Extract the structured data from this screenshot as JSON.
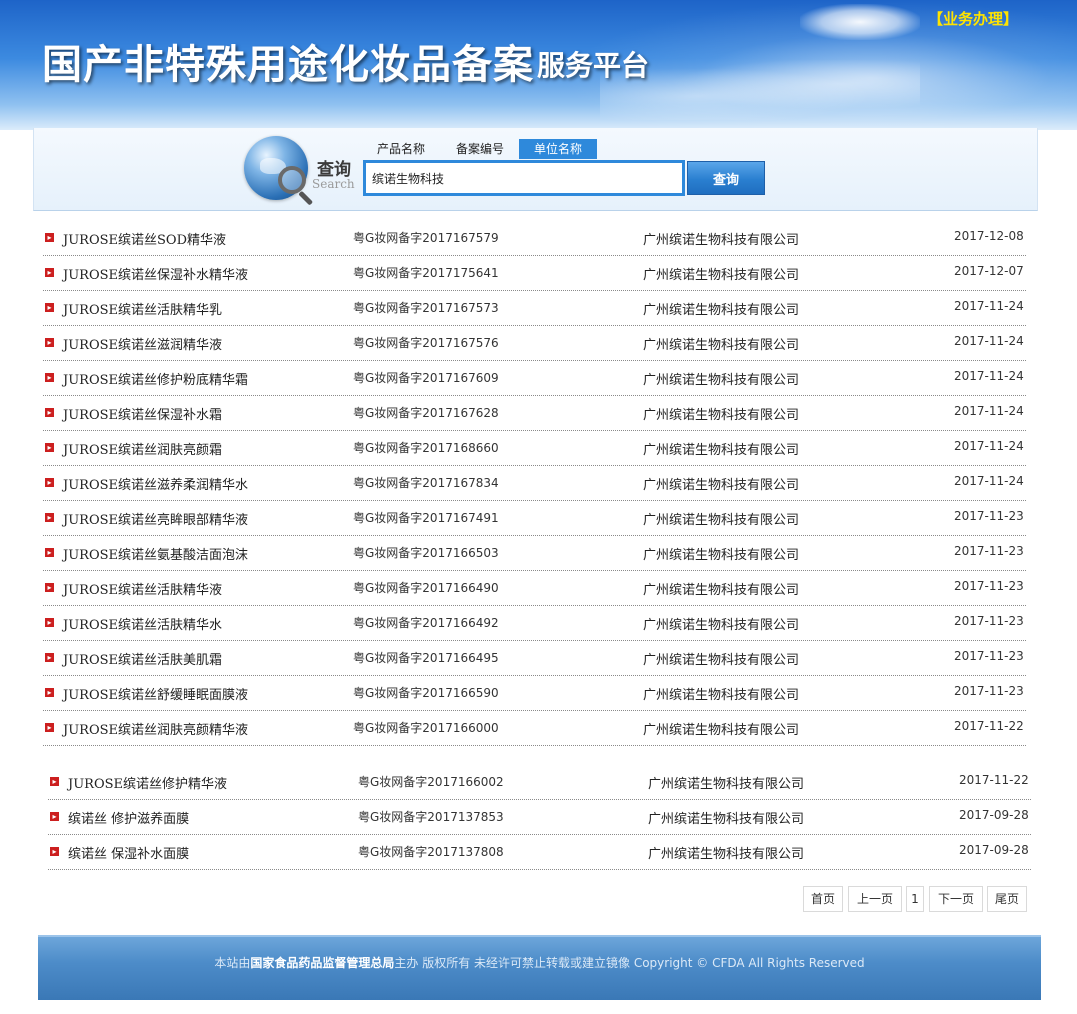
{
  "header": {
    "title": "国产非特殊用途化妆品备案",
    "subtitle": "服务平台",
    "business_link": "【业务办理】"
  },
  "search": {
    "label": "查询",
    "label_en": "Search",
    "tabs": [
      "产品名称",
      "备案编号",
      "单位名称"
    ],
    "active_tab": "单位名称",
    "query": "缤诺生物科技",
    "button": "查询"
  },
  "results": [
    {
      "name": "JUROSE缤诺丝SOD精华液",
      "code": "粤G妆网备字2017167579",
      "company": "广州缤诺生物科技有限公司",
      "date": "2017-12-08"
    },
    {
      "name": "JUROSE缤诺丝保湿补水精华液",
      "code": "粤G妆网备字2017175641",
      "company": "广州缤诺生物科技有限公司",
      "date": "2017-12-07"
    },
    {
      "name": "JUROSE缤诺丝活肤精华乳",
      "code": "粤G妆网备字2017167573",
      "company": "广州缤诺生物科技有限公司",
      "date": "2017-11-24"
    },
    {
      "name": "JUROSE缤诺丝滋润精华液",
      "code": "粤G妆网备字2017167576",
      "company": "广州缤诺生物科技有限公司",
      "date": "2017-11-24"
    },
    {
      "name": "JUROSE缤诺丝修护粉底精华霜",
      "code": "粤G妆网备字2017167609",
      "company": "广州缤诺生物科技有限公司",
      "date": "2017-11-24"
    },
    {
      "name": "JUROSE缤诺丝保湿补水霜",
      "code": "粤G妆网备字2017167628",
      "company": "广州缤诺生物科技有限公司",
      "date": "2017-11-24"
    },
    {
      "name": "JUROSE缤诺丝润肤亮颜霜",
      "code": "粤G妆网备字2017168660",
      "company": "广州缤诺生物科技有限公司",
      "date": "2017-11-24"
    },
    {
      "name": "JUROSE缤诺丝滋养柔润精华水",
      "code": "粤G妆网备字2017167834",
      "company": "广州缤诺生物科技有限公司",
      "date": "2017-11-24"
    },
    {
      "name": "JUROSE缤诺丝亮眸眼部精华液",
      "code": "粤G妆网备字2017167491",
      "company": "广州缤诺生物科技有限公司",
      "date": "2017-11-23"
    },
    {
      "name": "JUROSE缤诺丝氨基酸洁面泡沫",
      "code": "粤G妆网备字2017166503",
      "company": "广州缤诺生物科技有限公司",
      "date": "2017-11-23"
    },
    {
      "name": "JUROSE缤诺丝活肤精华液",
      "code": "粤G妆网备字2017166490",
      "company": "广州缤诺生物科技有限公司",
      "date": "2017-11-23"
    },
    {
      "name": "JUROSE缤诺丝活肤精华水",
      "code": "粤G妆网备字2017166492",
      "company": "广州缤诺生物科技有限公司",
      "date": "2017-11-23"
    },
    {
      "name": "JUROSE缤诺丝活肤美肌霜",
      "code": "粤G妆网备字2017166495",
      "company": "广州缤诺生物科技有限公司",
      "date": "2017-11-23"
    },
    {
      "name": "JUROSE缤诺丝舒缓睡眠面膜液",
      "code": "粤G妆网备字2017166590",
      "company": "广州缤诺生物科技有限公司",
      "date": "2017-11-23"
    },
    {
      "name": "JUROSE缤诺丝润肤亮颜精华液",
      "code": "粤G妆网备字2017166000",
      "company": "广州缤诺生物科技有限公司",
      "date": "2017-11-22"
    },
    {
      "name": "JUROSE缤诺丝修护精华液",
      "code": "粤G妆网备字2017166002",
      "company": "广州缤诺生物科技有限公司",
      "date": "2017-11-22"
    },
    {
      "name": "缤诺丝 修护滋养面膜",
      "code": "粤G妆网备字2017137853",
      "company": "广州缤诺生物科技有限公司",
      "date": "2017-09-28"
    },
    {
      "name": "缤诺丝 保湿补水面膜",
      "code": "粤G妆网备字2017137808",
      "company": "广州缤诺生物科技有限公司",
      "date": "2017-09-28"
    }
  ],
  "pagination": {
    "first": "首页",
    "prev": "上一页",
    "current": "1",
    "next": "下一页",
    "last": "尾页"
  },
  "footer": {
    "prefix": "本站由",
    "org": "国家食品药品监督管理总局",
    "suffix": "主办 版权所有 未经许可禁止转载或建立镜像 Copyright © CFDA All Rights Reserved"
  }
}
